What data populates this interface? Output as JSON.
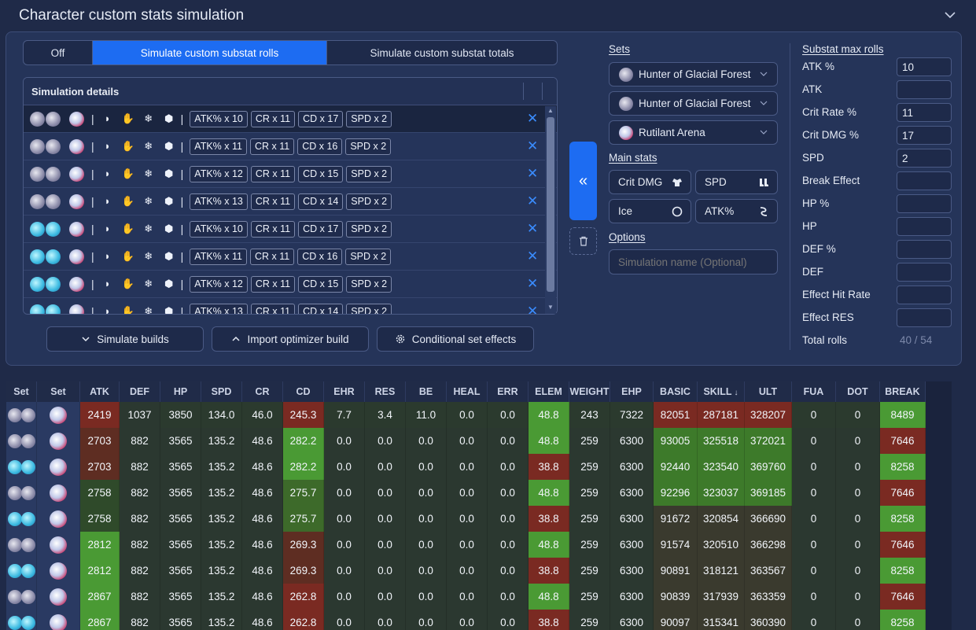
{
  "header": {
    "title": "Character custom stats simulation"
  },
  "mode_tabs": [
    {
      "label": "Off"
    },
    {
      "label": "Simulate custom substat rolls"
    },
    {
      "label": "Simulate custom substat totals"
    }
  ],
  "simulation": {
    "title": "Simulation details",
    "rows": [
      {
        "relic": "grey",
        "tags": [
          "ATK% x 10",
          "CR x 11",
          "CD x 17",
          "SPD x 2"
        ]
      },
      {
        "relic": "grey",
        "tags": [
          "ATK% x 11",
          "CR x 11",
          "CD x 16",
          "SPD x 2"
        ]
      },
      {
        "relic": "grey",
        "tags": [
          "ATK% x 12",
          "CR x 11",
          "CD x 15",
          "SPD x 2"
        ]
      },
      {
        "relic": "grey",
        "tags": [
          "ATK% x 13",
          "CR x 11",
          "CD x 14",
          "SPD x 2"
        ]
      },
      {
        "relic": "blue",
        "tags": [
          "ATK% x 10",
          "CR x 11",
          "CD x 17",
          "SPD x 2"
        ]
      },
      {
        "relic": "blue",
        "tags": [
          "ATK% x 11",
          "CR x 11",
          "CD x 16",
          "SPD x 2"
        ]
      },
      {
        "relic": "blue",
        "tags": [
          "ATK% x 12",
          "CR x 11",
          "CD x 15",
          "SPD x 2"
        ]
      },
      {
        "relic": "blue",
        "tags": [
          "ATK% x 13",
          "CR x 11",
          "CD x 14",
          "SPD x 2"
        ]
      }
    ]
  },
  "buttons": {
    "simulate": "Simulate builds",
    "import": "Import optimizer build",
    "conditional": "Conditional set effects"
  },
  "sets": {
    "label": "Sets",
    "relic1": "Hunter of Glacial Forest",
    "relic2": "Hunter of Glacial Forest",
    "ornament": "Rutilant Arena"
  },
  "main_stats": {
    "label": "Main stats",
    "body": "Crit DMG",
    "feet": "SPD",
    "sphere": "Ice",
    "rope": "ATK%"
  },
  "options": {
    "label": "Options",
    "placeholder": "Simulation name (Optional)"
  },
  "substat_max_rolls": {
    "label": "Substat max rolls",
    "items": [
      {
        "name": "ATK %",
        "value": "10"
      },
      {
        "name": "ATK",
        "value": ""
      },
      {
        "name": "Crit Rate %",
        "value": "11"
      },
      {
        "name": "Crit DMG %",
        "value": "17"
      },
      {
        "name": "SPD",
        "value": "2"
      },
      {
        "name": "Break Effect",
        "value": ""
      },
      {
        "name": "HP %",
        "value": ""
      },
      {
        "name": "HP",
        "value": ""
      },
      {
        "name": "DEF %",
        "value": ""
      },
      {
        "name": "DEF",
        "value": ""
      },
      {
        "name": "Effect Hit Rate",
        "value": ""
      },
      {
        "name": "Effect RES",
        "value": ""
      }
    ],
    "total_label": "Total rolls",
    "total_value": "40 / 54"
  },
  "results": {
    "columns": [
      "Set",
      "Set",
      "ATK",
      "DEF",
      "HP",
      "SPD",
      "CR",
      "CD",
      "EHR",
      "RES",
      "BE",
      "HEAL",
      "ERR",
      "ELEM",
      "WEIGHT",
      "EHP",
      "BASIC",
      "SKILL",
      "ULT",
      "FUA",
      "DOT",
      "BREAK"
    ],
    "sort_indicator": "↓",
    "colors": {
      "red": "#7a2a22",
      "green": "#3d7a2a",
      "bright_green": "#4a9a34",
      "neutral": "#3a4a2e",
      "dark": "#2b3830"
    },
    "rows": [
      {
        "relic": "grey",
        "v": [
          "2419",
          "1037",
          "3850",
          "134.0",
          "46.0",
          "245.3",
          "7.7",
          "3.4",
          "11.0",
          "0.0",
          "0.0",
          "48.8",
          "243",
          "7322",
          "82051",
          "287181",
          "328207",
          "0",
          "0",
          "8489"
        ]
      },
      {
        "relic": "grey",
        "v": [
          "2703",
          "882",
          "3565",
          "135.2",
          "48.6",
          "282.2",
          "0.0",
          "0.0",
          "0.0",
          "0.0",
          "0.0",
          "48.8",
          "259",
          "6300",
          "93005",
          "325518",
          "372021",
          "0",
          "0",
          "7646"
        ]
      },
      {
        "relic": "blue",
        "v": [
          "2703",
          "882",
          "3565",
          "135.2",
          "48.6",
          "282.2",
          "0.0",
          "0.0",
          "0.0",
          "0.0",
          "0.0",
          "38.8",
          "259",
          "6300",
          "92440",
          "323540",
          "369760",
          "0",
          "0",
          "8258"
        ]
      },
      {
        "relic": "grey",
        "v": [
          "2758",
          "882",
          "3565",
          "135.2",
          "48.6",
          "275.7",
          "0.0",
          "0.0",
          "0.0",
          "0.0",
          "0.0",
          "48.8",
          "259",
          "6300",
          "92296",
          "323037",
          "369185",
          "0",
          "0",
          "7646"
        ]
      },
      {
        "relic": "blue",
        "v": [
          "2758",
          "882",
          "3565",
          "135.2",
          "48.6",
          "275.7",
          "0.0",
          "0.0",
          "0.0",
          "0.0",
          "0.0",
          "38.8",
          "259",
          "6300",
          "91672",
          "320854",
          "366690",
          "0",
          "0",
          "8258"
        ]
      },
      {
        "relic": "grey",
        "v": [
          "2812",
          "882",
          "3565",
          "135.2",
          "48.6",
          "269.3",
          "0.0",
          "0.0",
          "0.0",
          "0.0",
          "0.0",
          "48.8",
          "259",
          "6300",
          "91574",
          "320510",
          "366298",
          "0",
          "0",
          "7646"
        ]
      },
      {
        "relic": "blue",
        "v": [
          "2812",
          "882",
          "3565",
          "135.2",
          "48.6",
          "269.3",
          "0.0",
          "0.0",
          "0.0",
          "0.0",
          "0.0",
          "38.8",
          "259",
          "6300",
          "90891",
          "318121",
          "363567",
          "0",
          "0",
          "8258"
        ]
      },
      {
        "relic": "grey",
        "v": [
          "2867",
          "882",
          "3565",
          "135.2",
          "48.6",
          "262.8",
          "0.0",
          "0.0",
          "0.0",
          "0.0",
          "0.0",
          "48.8",
          "259",
          "6300",
          "90839",
          "317939",
          "363359",
          "0",
          "0",
          "7646"
        ]
      },
      {
        "relic": "blue",
        "v": [
          "2867",
          "882",
          "3565",
          "135.2",
          "48.6",
          "262.8",
          "0.0",
          "0.0",
          "0.0",
          "0.0",
          "0.0",
          "38.8",
          "259",
          "6300",
          "90097",
          "315341",
          "360390",
          "0",
          "0",
          "8258"
        ]
      }
    ]
  }
}
